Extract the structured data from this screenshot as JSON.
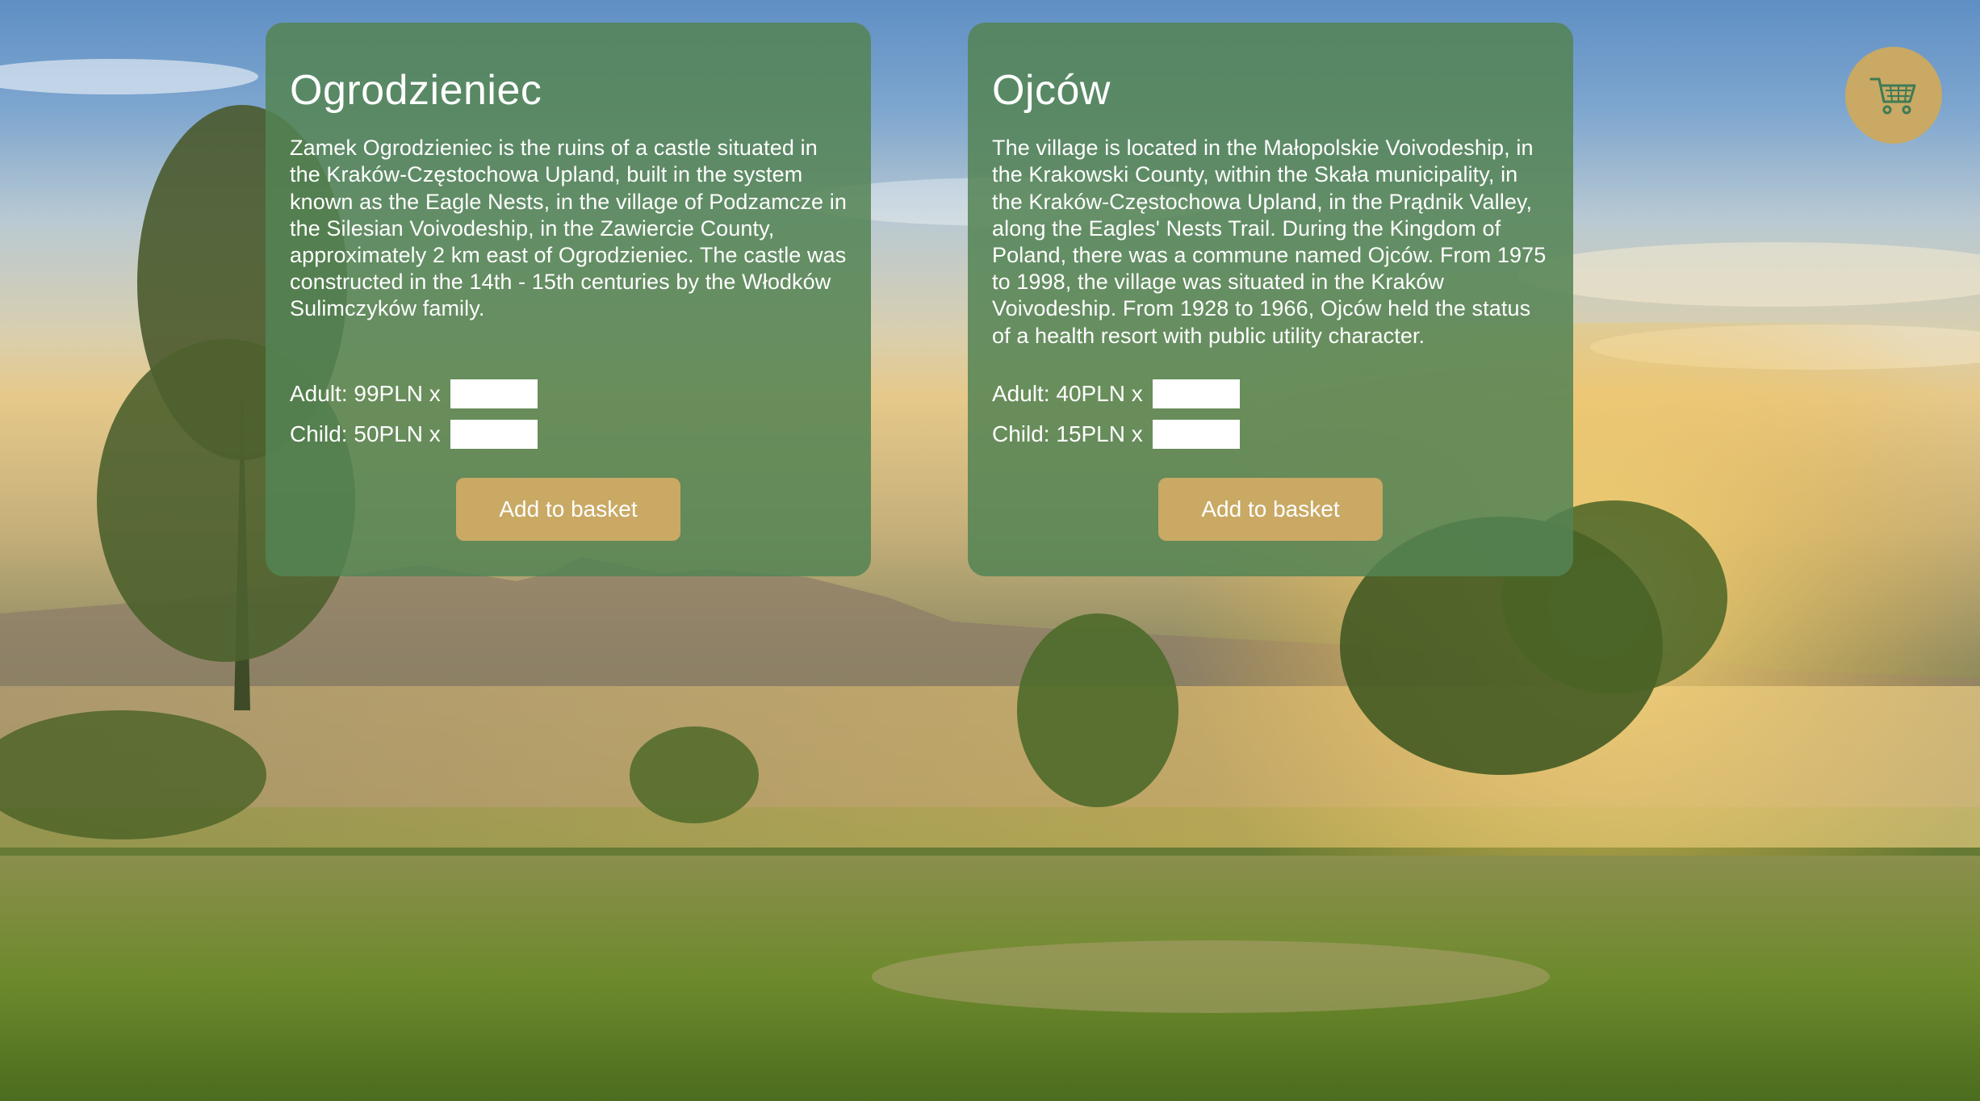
{
  "cards": [
    {
      "title": "Ogrodzieniec",
      "description": "Zamek Ogrodzieniec is the ruins of a castle situated in the Kraków-Częstochowa Upland, built in the system known as the Eagle Nests, in the village of Podzamcze in the Silesian Voivodeship, in the Zawiercie County, approximately 2 km east of Ogrodzieniec. The castle was constructed in the 14th - 15th centuries by the Włodków Sulimczyków family.",
      "adult_label": "Adult: 99PLN x",
      "child_label": "Child: 50PLN x",
      "adult_value": "",
      "child_value": "",
      "button_label": "Add to basket"
    },
    {
      "title": "Ojców",
      "description": "The village is located in the Małopolskie Voivodeship, in the Krakowski County, within the Skała municipality, in the Kraków-Częstochowa Upland, in the Prądnik Valley, along the Eagles' Nests Trail. During the Kingdom of Poland, there was a commune named Ojców. From 1975 to 1998, the village was situated in the Kraków Voivodeship. From 1928 to 1966, Ojców held the status of a health resort with public utility character.",
      "adult_label": "Adult: 40PLN x",
      "child_label": "Child: 15PLN x",
      "adult_value": "",
      "child_value": "",
      "button_label": "Add to basket"
    }
  ],
  "cart": {
    "icon": "shopping-cart-icon"
  },
  "colors": {
    "card_bg": "#548454",
    "accent": "#c9a964",
    "text": "#ffffff"
  }
}
